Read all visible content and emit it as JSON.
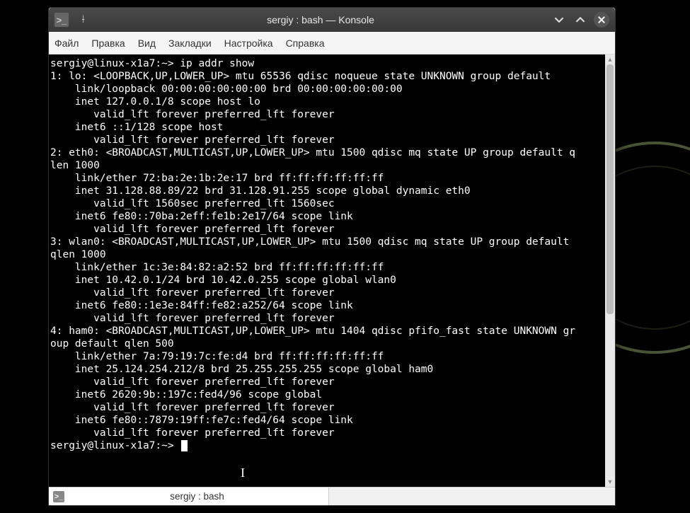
{
  "window": {
    "title": "sergiy : bash — Konsole"
  },
  "menu": {
    "items": [
      "Файл",
      "Правка",
      "Вид",
      "Закладки",
      "Настройка",
      "Справка"
    ]
  },
  "terminal": {
    "prompt1": "sergiy@linux-x1a7:~> ",
    "command1": "ip addr show",
    "output": "1: lo: <LOOPBACK,UP,LOWER_UP> mtu 65536 qdisc noqueue state UNKNOWN group default\n    link/loopback 00:00:00:00:00:00 brd 00:00:00:00:00:00\n    inet 127.0.0.1/8 scope host lo\n       valid_lft forever preferred_lft forever\n    inet6 ::1/128 scope host\n       valid_lft forever preferred_lft forever\n2: eth0: <BROADCAST,MULTICAST,UP,LOWER_UP> mtu 1500 qdisc mq state UP group default q\nlen 1000\n    link/ether 72:ba:2e:1b:2e:17 brd ff:ff:ff:ff:ff:ff\n    inet 31.128.88.89/22 brd 31.128.91.255 scope global dynamic eth0\n       valid_lft 1560sec preferred_lft 1560sec\n    inet6 fe80::70ba:2eff:fe1b:2e17/64 scope link\n       valid_lft forever preferred_lft forever\n3: wlan0: <BROADCAST,MULTICAST,UP,LOWER_UP> mtu 1500 qdisc mq state UP group default \nqlen 1000\n    link/ether 1c:3e:84:82:a2:52 brd ff:ff:ff:ff:ff:ff\n    inet 10.42.0.1/24 brd 10.42.0.255 scope global wlan0\n       valid_lft forever preferred_lft forever\n    inet6 fe80::1e3e:84ff:fe82:a252/64 scope link\n       valid_lft forever preferred_lft forever\n4: ham0: <BROADCAST,MULTICAST,UP,LOWER_UP> mtu 1404 qdisc pfifo_fast state UNKNOWN gr\noup default qlen 500\n    link/ether 7a:79:19:7c:fe:d4 brd ff:ff:ff:ff:ff:ff\n    inet 25.124.254.212/8 brd 25.255.255.255 scope global ham0\n       valid_lft forever preferred_lft forever\n    inet6 2620:9b::197c:fed4/96 scope global\n       valid_lft forever preferred_lft forever\n    inet6 fe80::7879:19ff:fe7c:fed4/64 scope link\n       valid_lft forever preferred_lft forever",
    "prompt2": "sergiy@linux-x1a7:~> "
  },
  "tab": {
    "label": "sergiy : bash"
  },
  "icons": {
    "prompt_glyph": ">_",
    "pin": "📌",
    "min": "⌄",
    "max": "⌃",
    "close": "✕"
  }
}
